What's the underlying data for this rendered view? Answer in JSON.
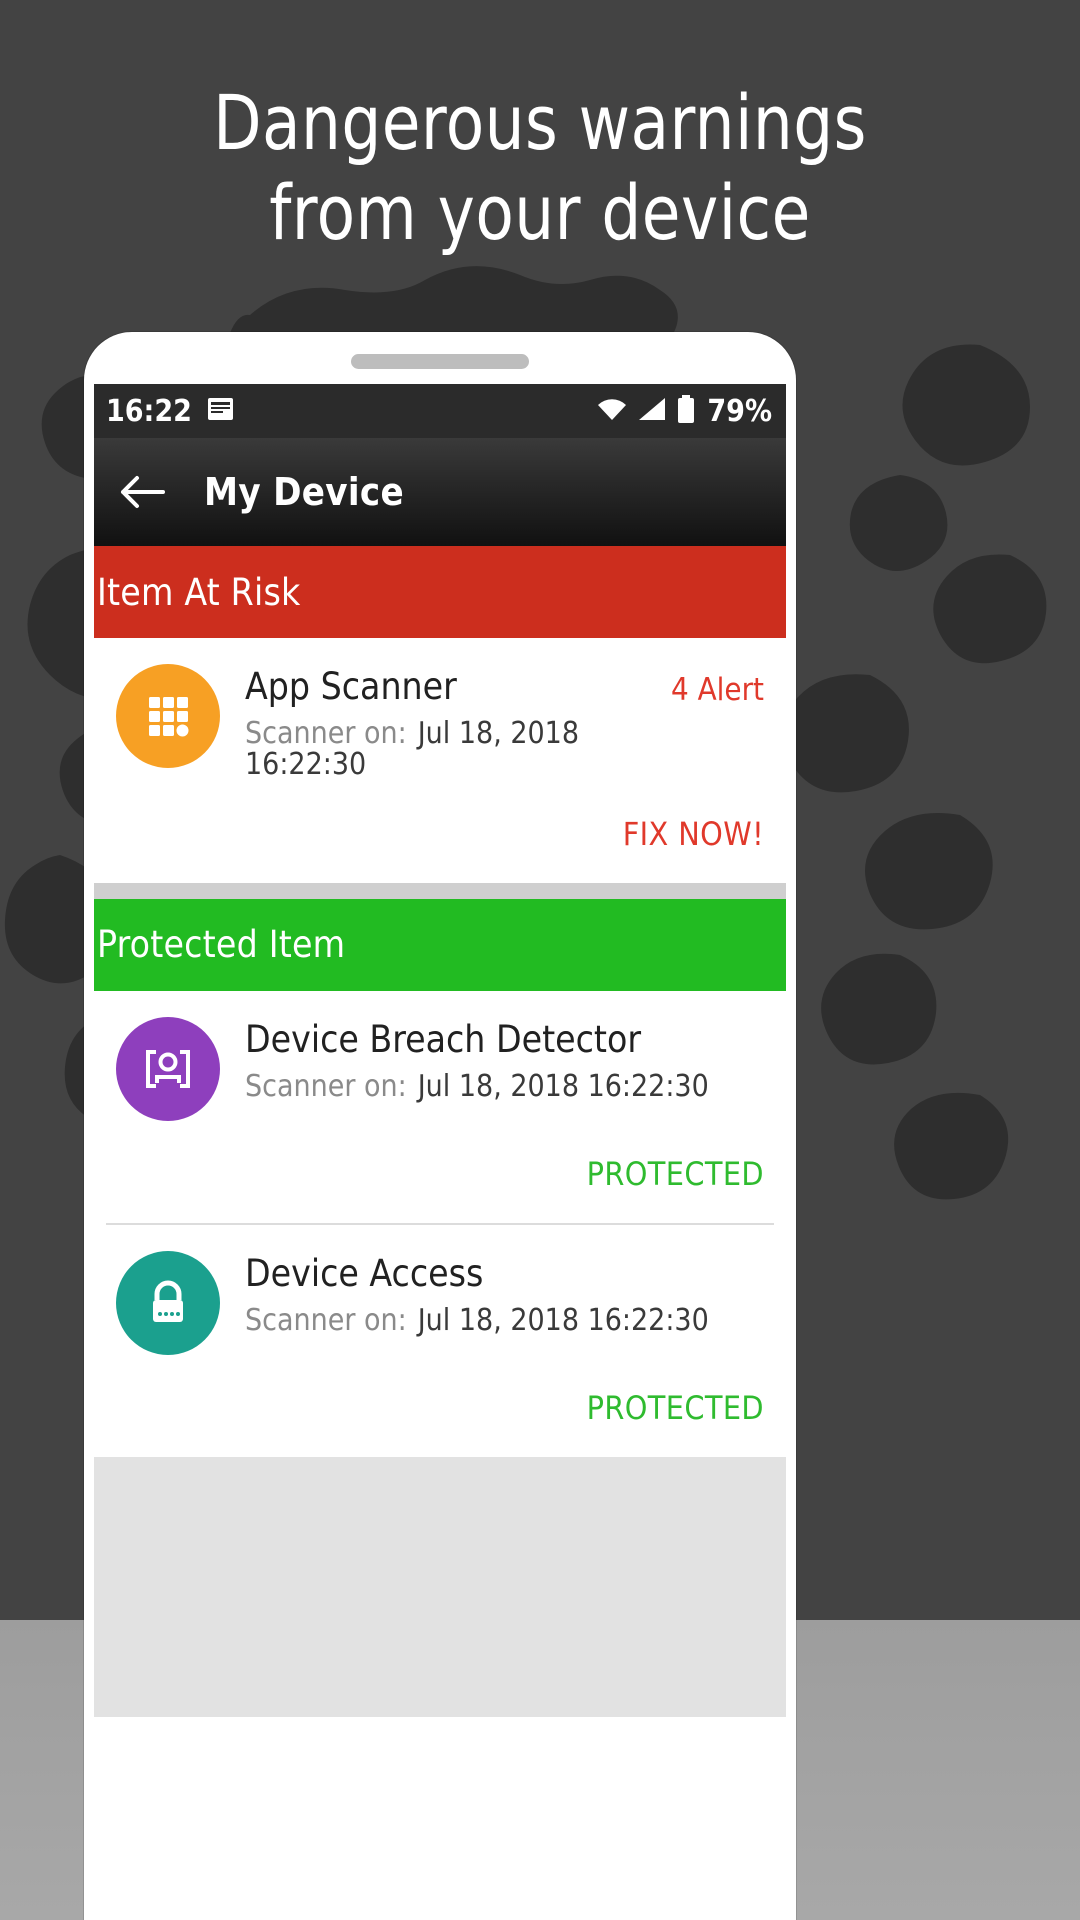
{
  "promo": {
    "headline_line1": "Dangerous warnings",
    "headline_line2": "from your device",
    "background_color": "#434343",
    "text_color": "#ffffff"
  },
  "phone": {
    "statusbar": {
      "time": "16:22",
      "notification_icon": "news-card-icon",
      "wifi_icon": "wifi-icon",
      "signal_icon": "signal-bars-icon",
      "battery_icon": "battery-full-icon",
      "battery_percent": "79%",
      "background_color": "#2b2b2b"
    },
    "actionbar": {
      "back_icon": "back-arrow-icon",
      "title": "My Device"
    },
    "sections": [
      {
        "id": "item-at-risk",
        "header": "Item At Risk",
        "header_color": "#cc2e1e",
        "items": [
          {
            "icon": "app-grid-icon",
            "icon_color": "#f7a024",
            "title": "App Scanner",
            "scanner_label": "Scanner on:",
            "scanner_value": "Jul 18, 2018 16:22:30",
            "status_right": "4 Alert",
            "status_right_color": "#e0392b",
            "action": "FIX NOW!",
            "action_color": "#e0392b"
          }
        ]
      },
      {
        "id": "protected-item",
        "header": "Protected Item",
        "header_color": "#22bb22",
        "items": [
          {
            "icon": "person-scan-icon",
            "icon_color": "#8e3fbd",
            "title": "Device Breach Detector",
            "scanner_label": "Scanner on:",
            "scanner_value": "Jul 18, 2018 16:22:30",
            "status_right": "",
            "action": "PROTECTED",
            "action_color": "#2fbb2f"
          },
          {
            "icon": "padlock-icon",
            "icon_color": "#1ba08e",
            "title": "Device Access",
            "scanner_label": "Scanner on:",
            "scanner_value": "Jul 18, 2018 16:22:30",
            "status_right": "",
            "action": "PROTECTED",
            "action_color": "#2fbb2f"
          }
        ]
      }
    ]
  }
}
